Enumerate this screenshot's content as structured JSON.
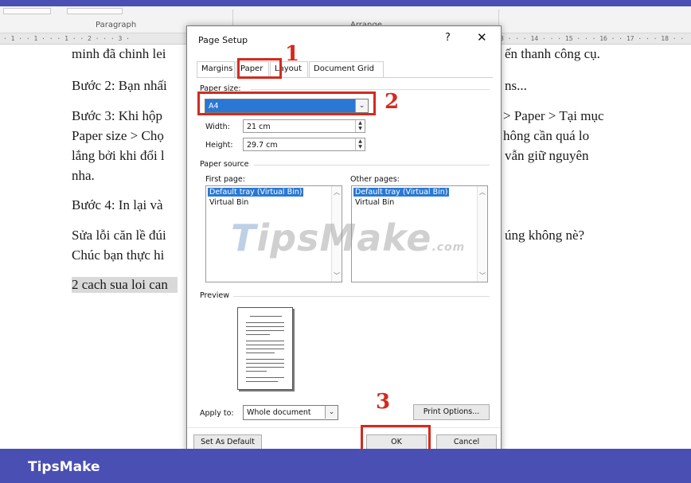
{
  "word": {
    "ribbon": {
      "paragraph_group": "Paragraph",
      "arrange_group": "Arrange"
    },
    "ruler_left": "· 1 · · 1 · · · 1 · · 2 · · · 3 ·",
    "ruler_right": "3 · · · 14 · · · 15 · · · 16 · · 17 · · · 18 · ·",
    "lines": [
      {
        "text": "minh đã chinh lei",
        "right": "ến thanh công cụ."
      },
      {
        "text": "Bước 2: Bạn nhấi",
        "right": "ns..."
      },
      {
        "text": "Bước 3: Khi hộp",
        "right": "> Paper > Tại mục"
      },
      {
        "text": "Paper size > Chọ",
        "right": "hông cần quá lo"
      },
      {
        "text": "lắng bởi khi đổi l",
        "right": "vẫn giữ nguyên"
      },
      {
        "text": "nha.",
        "right": ""
      },
      {
        "text": "Bước 4: In lại và",
        "right": ""
      },
      {
        "text": "Sửa lỗi căn lề đúi",
        "right": "úng không nè?"
      },
      {
        "text": "Chúc bạn thực hi",
        "right": ""
      },
      {
        "text": "2 cach sua loi can",
        "right": ""
      }
    ]
  },
  "dialog": {
    "title": "Page Setup",
    "help": "?",
    "close": "✕",
    "tabs": [
      "Margins",
      "Paper",
      "Layout",
      "Document Grid"
    ],
    "paper_size_label": "Paper size:",
    "paper_size_value": "A4",
    "width_label": "Width:",
    "width_value": "21 cm",
    "height_label": "Height:",
    "height_value": "29.7 cm",
    "paper_source_label": "Paper source",
    "first_page_label": "First page:",
    "other_pages_label": "Other pages:",
    "first_page_items": [
      "Default tray (Virtual Bin)",
      "Virtual Bin"
    ],
    "other_pages_items": [
      "Default tray (Virtual Bin)",
      "Virtual Bin"
    ],
    "preview_label": "Preview",
    "apply_to_label": "Apply to:",
    "apply_to_value": "Whole document",
    "print_options": "Print Options...",
    "set_as_default": "Set As Default",
    "ok": "OK",
    "cancel": "Cancel"
  },
  "annotations": {
    "n1": "1",
    "n2": "2",
    "n3": "3",
    "color": "#d42a1e"
  },
  "watermark": {
    "t": "T",
    "rest": "ipsMake",
    "suffix": ".com"
  },
  "footer": {
    "brand": "TipsMake",
    "color": "#4a4fb3"
  }
}
